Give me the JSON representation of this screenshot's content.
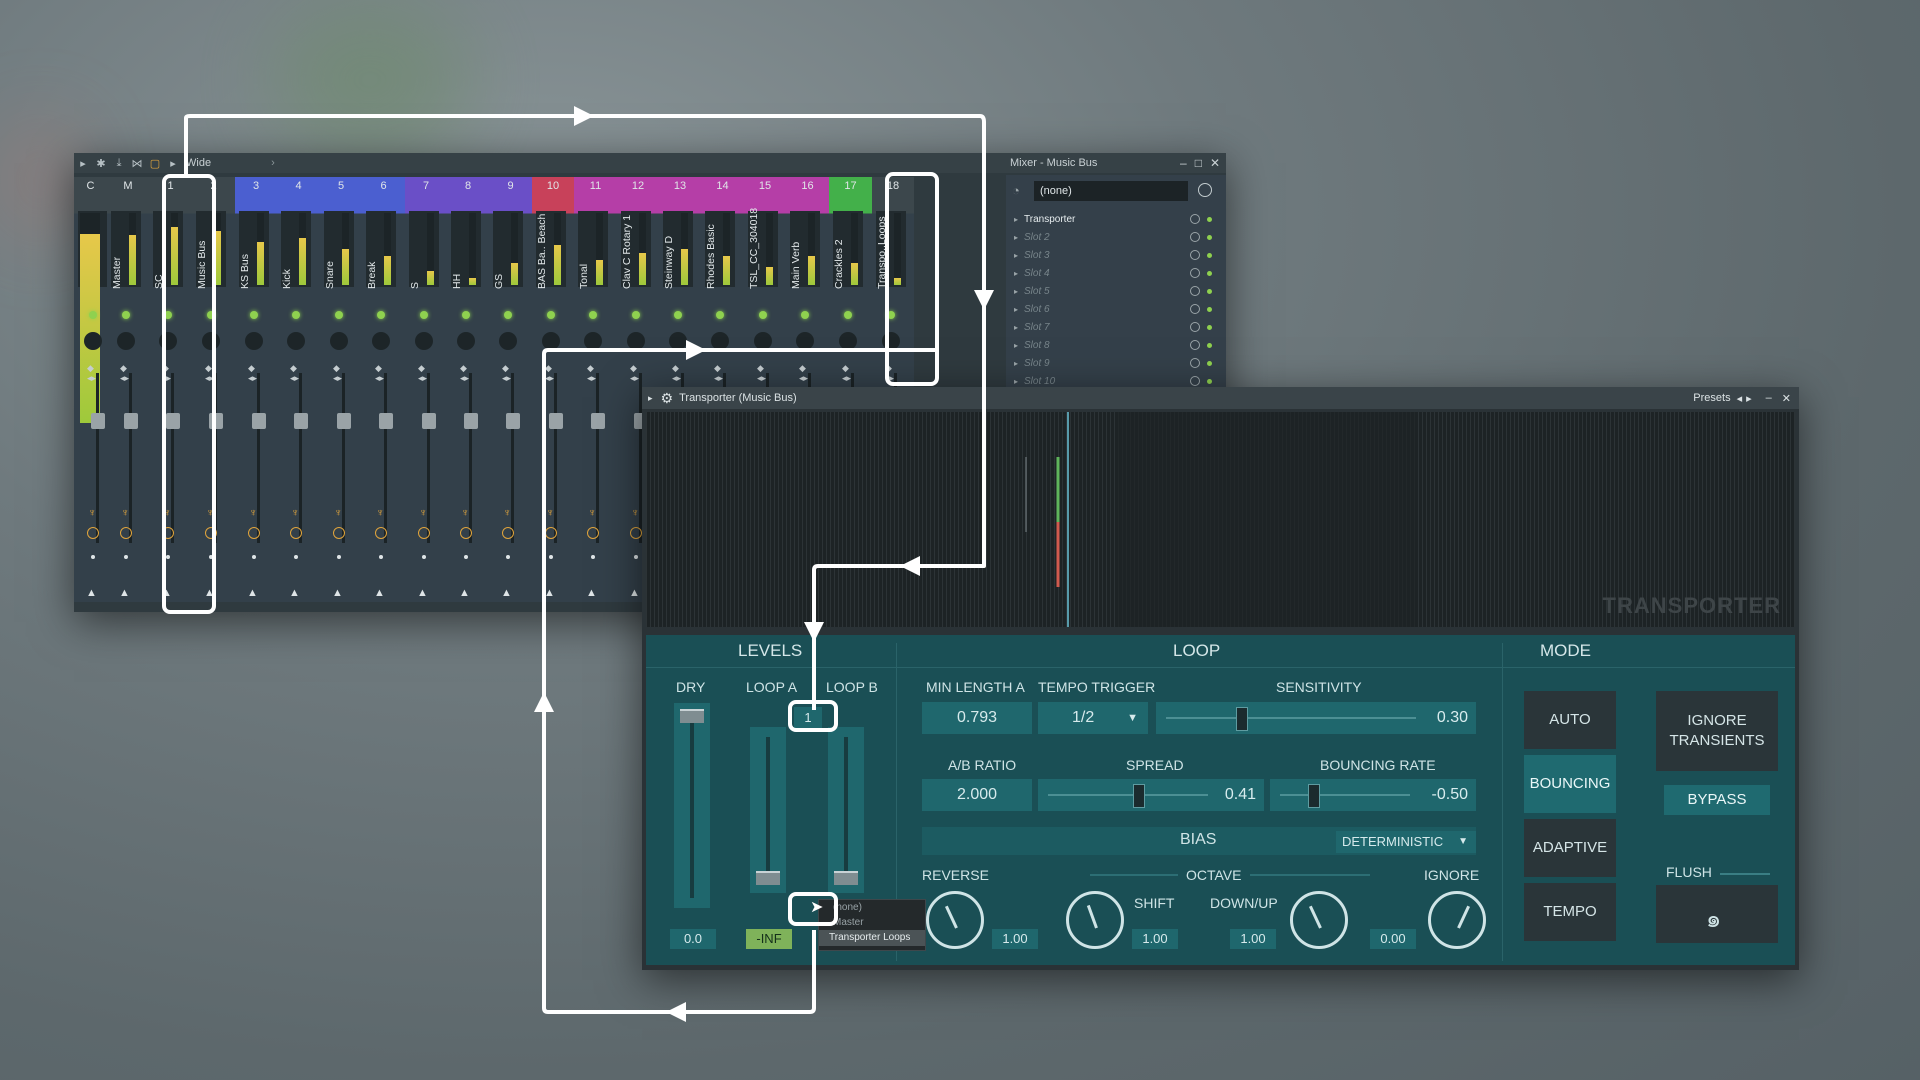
{
  "mixer": {
    "toolbar": {
      "preset_label": "Wide"
    },
    "title": "Mixer - Music Bus",
    "strips": [
      {
        "num": "C",
        "name": "",
        "color": "#3c474c"
      },
      {
        "num": "M",
        "name": "Master",
        "color": "#3c474c"
      },
      {
        "num": "1",
        "name": "SC",
        "color": "#3c474c"
      },
      {
        "num": "2",
        "name": "Music Bus",
        "color": "#3c474c"
      },
      {
        "num": "3",
        "name": "KS Bus",
        "color": "#4b5fd0"
      },
      {
        "num": "4",
        "name": "Kick",
        "color": "#4b5fd0"
      },
      {
        "num": "5",
        "name": "Snare",
        "color": "#4b5fd0"
      },
      {
        "num": "6",
        "name": "Break",
        "color": "#4b5fd0"
      },
      {
        "num": "7",
        "name": "S",
        "color": "#6a4fc7"
      },
      {
        "num": "8",
        "name": "HH",
        "color": "#6a4fc7"
      },
      {
        "num": "9",
        "name": "GS",
        "color": "#6a4fc7"
      },
      {
        "num": "10",
        "name": "BAS Ba.. Beach",
        "color": "#c8415a"
      },
      {
        "num": "11",
        "name": "Tonal",
        "color": "#b53ea7"
      },
      {
        "num": "12",
        "name": "Clav C Rotary 1",
        "color": "#b53ea7"
      },
      {
        "num": "13",
        "name": "Steinway D",
        "color": "#b53ea7"
      },
      {
        "num": "14",
        "name": "Rhodes Basic",
        "color": "#b53ea7"
      },
      {
        "num": "15",
        "name": "TSL_CC_304018",
        "color": "#b53ea7"
      },
      {
        "num": "16",
        "name": "Main Verb",
        "color": "#b53ea7"
      },
      {
        "num": "17",
        "name": "Crackles 2",
        "color": "#43b04a"
      },
      {
        "num": "18",
        "name": "Transpo..Loops",
        "color": "#3c474c"
      }
    ],
    "slots": {
      "preset": "(none)",
      "items": [
        "Transporter",
        "Slot 2",
        "Slot 3",
        "Slot 4",
        "Slot 5",
        "Slot 6",
        "Slot 7",
        "Slot 8",
        "Slot 9",
        "Slot 10"
      ]
    }
  },
  "plugin": {
    "title": "Transporter (Music Bus)",
    "presets_label": "Presets",
    "logo": "TRANSPORTER",
    "levels": {
      "heading": "LEVELS",
      "dry_label": "DRY",
      "loop_a_label": "LOOP A",
      "loop_b_label": "LOOP B",
      "loop_a_route": "1",
      "dry_value": "0.0",
      "loop_value": "-INF",
      "route_menu": [
        "(none)",
        "Master",
        "Transporter Loops"
      ]
    },
    "loop": {
      "heading": "LOOP",
      "min_length_label": "MIN LENGTH A",
      "min_length_value": "0.793",
      "tempo_trigger_label": "TEMPO TRIGGER",
      "tempo_trigger_value": "1/2",
      "sensitivity_label": "SENSITIVITY",
      "sensitivity_value": "0.30",
      "sensitivity_level": 0.3,
      "ab_ratio_label": "A/B RATIO",
      "ab_ratio_value": "2.000",
      "spread_label": "SPREAD",
      "spread_value": "0.41",
      "spread_level": 0.41,
      "bouncing_rate_label": "BOUNCING RATE",
      "bouncing_rate_value": "-0.50",
      "bouncing_rate_level": 0.25,
      "bias_label": "BIAS",
      "bias_mode": "DETERMINISTIC",
      "reverse_label": "REVERSE",
      "reverse_value": "1.00",
      "octave_label": "OCTAVE",
      "shift_label": "SHIFT",
      "shift_value": "1.00",
      "downup_label": "DOWN/UP",
      "downup_value": "1.00",
      "ignore_label": "IGNORE",
      "ignore_value": "0.00"
    },
    "mode": {
      "heading": "MODE",
      "auto": "AUTO",
      "bouncing": "BOUNCING",
      "adaptive": "ADAPTIVE",
      "tempo": "TEMPO",
      "ignore_transients": "IGNORE TRANSIENTS",
      "bypass": "BYPASS",
      "flush_label": "FLUSH"
    }
  },
  "colors": {
    "accent": "#1f676d",
    "panel": "#1a4f55",
    "led_green": "#8fd14f",
    "annotation": "#ffffff"
  }
}
